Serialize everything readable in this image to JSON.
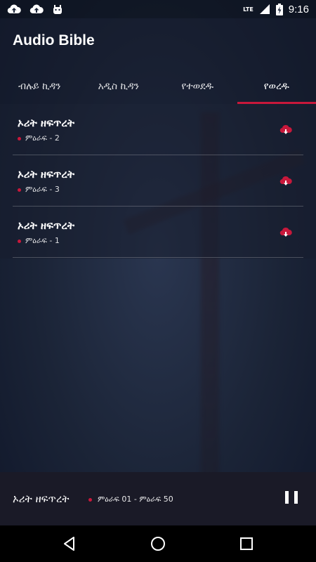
{
  "status_bar": {
    "time": "9:16",
    "network": "LTE",
    "left_icons": [
      "cloud-upload-icon",
      "cloud-upload-icon",
      "android-icon"
    ],
    "right_icons": [
      "signal-icon",
      "battery-charging-icon"
    ]
  },
  "app": {
    "title": "Audio Bible",
    "accent_color": "#c8183b"
  },
  "tabs": [
    {
      "label": "ብሉይ ኪዳን",
      "active": false
    },
    {
      "label": "አዲስ ኪዳን",
      "active": false
    },
    {
      "label": "የተወደዱ",
      "active": false
    },
    {
      "label": "የወረዱ",
      "active": true
    }
  ],
  "downloads": [
    {
      "title": "ኦሪት ዘፍጥረት",
      "subtitle": "ምዕራፍ - 2"
    },
    {
      "title": "ኦሪት ዘፍጥረት",
      "subtitle": "ምዕራፍ - 3"
    },
    {
      "title": "ኦሪት ዘፍጥረት",
      "subtitle": "ምዕራፍ - 1"
    }
  ],
  "player": {
    "title": "ኦሪት ዘፍጥረት",
    "subtitle": "ምዕራፍ 01 - ምዕራፍ 50",
    "state_icon": "pause-icon"
  },
  "nav_bar": [
    "back-icon",
    "home-icon",
    "recents-icon"
  ]
}
